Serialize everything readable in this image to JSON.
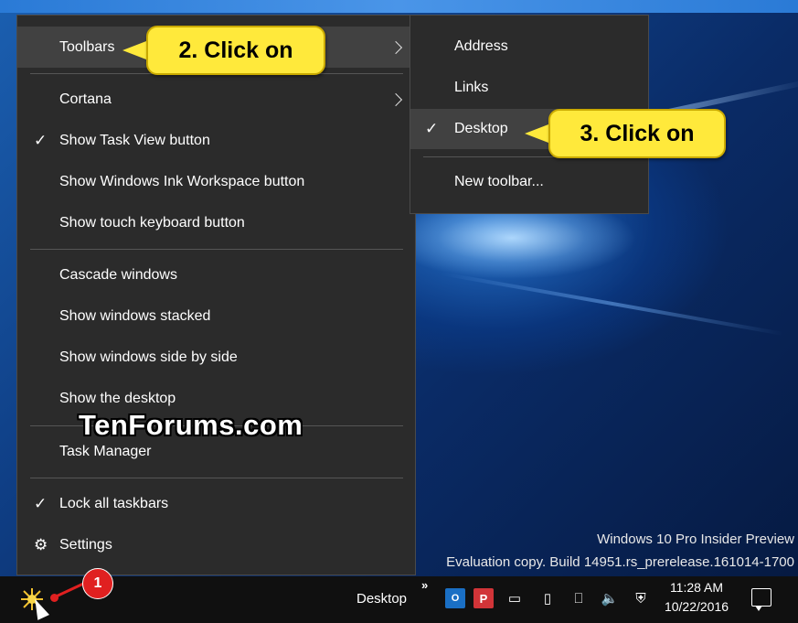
{
  "context_menu": {
    "items": [
      {
        "label": "Toolbars",
        "has_submenu": true,
        "highlighted": true
      },
      {
        "label": "Cortana",
        "has_submenu": true
      },
      {
        "label": "Show Task View button",
        "checked": true
      },
      {
        "label": "Show Windows Ink Workspace button"
      },
      {
        "label": "Show touch keyboard button"
      },
      {
        "label": "Cascade windows"
      },
      {
        "label": "Show windows stacked"
      },
      {
        "label": "Show windows side by side"
      },
      {
        "label": "Show the desktop"
      },
      {
        "label": "Task Manager"
      },
      {
        "label": "Lock all taskbars",
        "checked": true
      },
      {
        "label": "Settings",
        "icon": "gear-icon"
      }
    ]
  },
  "toolbars_submenu": {
    "items": [
      {
        "label": "Address"
      },
      {
        "label": "Links"
      },
      {
        "label": "Desktop",
        "checked": true,
        "highlighted": true
      },
      {
        "label": "New toolbar..."
      }
    ]
  },
  "callouts": {
    "step2": "2. Click on",
    "step3": "3. Click on",
    "step1": "1"
  },
  "watermark": "TenForums.com",
  "build_info": {
    "line1": "Windows 10 Pro Insider Preview",
    "line2": "Evaluation copy. Build 14951.rs_prerelease.161014-1700"
  },
  "taskbar": {
    "desktop_toolbar_label": "Desktop",
    "overflow_chevron": "»",
    "clock_time": "11:28 AM",
    "clock_date": "10/22/2016"
  },
  "colors": {
    "menu_bg": "#2b2b2b",
    "menu_highlight": "#414141",
    "callout_yellow": "#ffe93b",
    "step_badge_red": "#e02020",
    "taskbar_bg": "#101010"
  }
}
